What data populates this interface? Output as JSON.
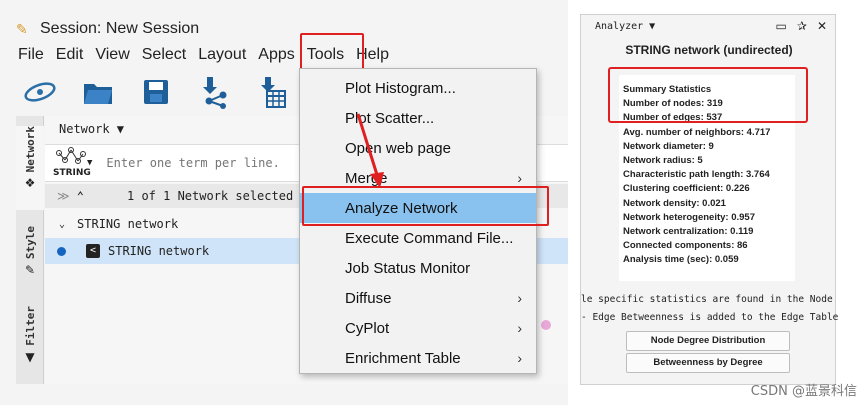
{
  "window": {
    "title": "Session: New Session"
  },
  "menubar": [
    "File",
    "Edit",
    "View",
    "Select",
    "Layout",
    "Apps",
    "Tools",
    "Help"
  ],
  "network_panel": {
    "header": "Network ▼",
    "search_placeholder": "Enter one term per line.",
    "search_logo": "STRING",
    "selection_status": "1 of 1 Network selected",
    "collection": "STRING network",
    "network": "STRING network"
  },
  "side_tabs": [
    "Network",
    "Style",
    "Filter"
  ],
  "tools_menu": [
    {
      "label": "Plot Histogram...",
      "submenu": false
    },
    {
      "label": "Plot Scatter...",
      "submenu": false
    },
    {
      "label": "Open web page",
      "submenu": false
    },
    {
      "label": "Merge",
      "submenu": true
    },
    {
      "label": "Analyze Network",
      "submenu": false,
      "highlighted": true
    },
    {
      "label": "Execute Command File...",
      "submenu": false
    },
    {
      "label": "Job Status Monitor",
      "submenu": false
    },
    {
      "label": "Diffuse",
      "submenu": true
    },
    {
      "label": "CyPlot",
      "submenu": true
    },
    {
      "label": "Enrichment Table",
      "submenu": true
    }
  ],
  "analyzer": {
    "header": "Analyzer ▼",
    "title": "STRING network (undirected)",
    "stats": [
      "Summary Statistics",
      "Number of nodes: 319",
      "Number of edges: 537",
      "Avg. number of neighbors:  4.717",
      "Network diameter:  9",
      "Network radius:  5",
      "Characteristic path length:  3.764",
      "Clustering coefficient:  0.226",
      "Network density:  0.021",
      "Network heterogeneity:  0.957",
      "Network centralization:  0.119",
      "Connected components:  86",
      "Analysis time (sec):  0.059"
    ],
    "note1": "le specific statistics are found in the Node",
    "note2": "- Edge Betweenness is added to the Edge Table",
    "btn_degree": "Node Degree Distribution",
    "btn_betweenness": "Betweenness by Degree"
  },
  "watermark": "CSDN @蓝景科信",
  "colors": {
    "highlight": "#89c2ee",
    "annotation_red": "#e02020",
    "selection": "#cfe4f8"
  }
}
